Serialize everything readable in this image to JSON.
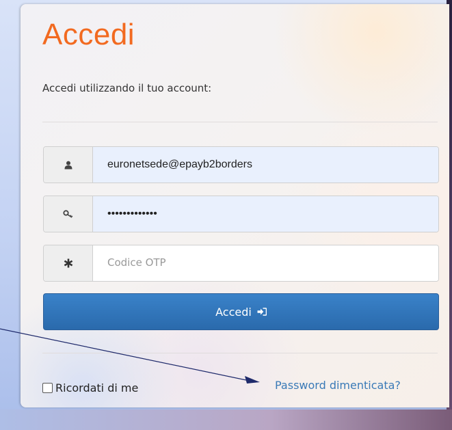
{
  "login": {
    "title": "Accedi",
    "subtitle": "Accedi utilizzando il tuo account:",
    "username": {
      "value": "euronetsede@epayb2borders",
      "icon": "user-icon"
    },
    "password": {
      "value": "password12345",
      "icon": "key-icon"
    },
    "otp": {
      "placeholder": "Codice OTP",
      "value": "",
      "icon": "asterisk-icon"
    },
    "submit_label": "Accedi",
    "submit_icon": "sign-in-icon",
    "remember_label": "Ricordati di me",
    "remember_checked": false,
    "forgot_label": "Password dimenticata?"
  },
  "colors": {
    "title": "#f26a20",
    "button": "#2f72b8",
    "link": "#3a7ab7",
    "autofill": "#e9f0fd"
  }
}
